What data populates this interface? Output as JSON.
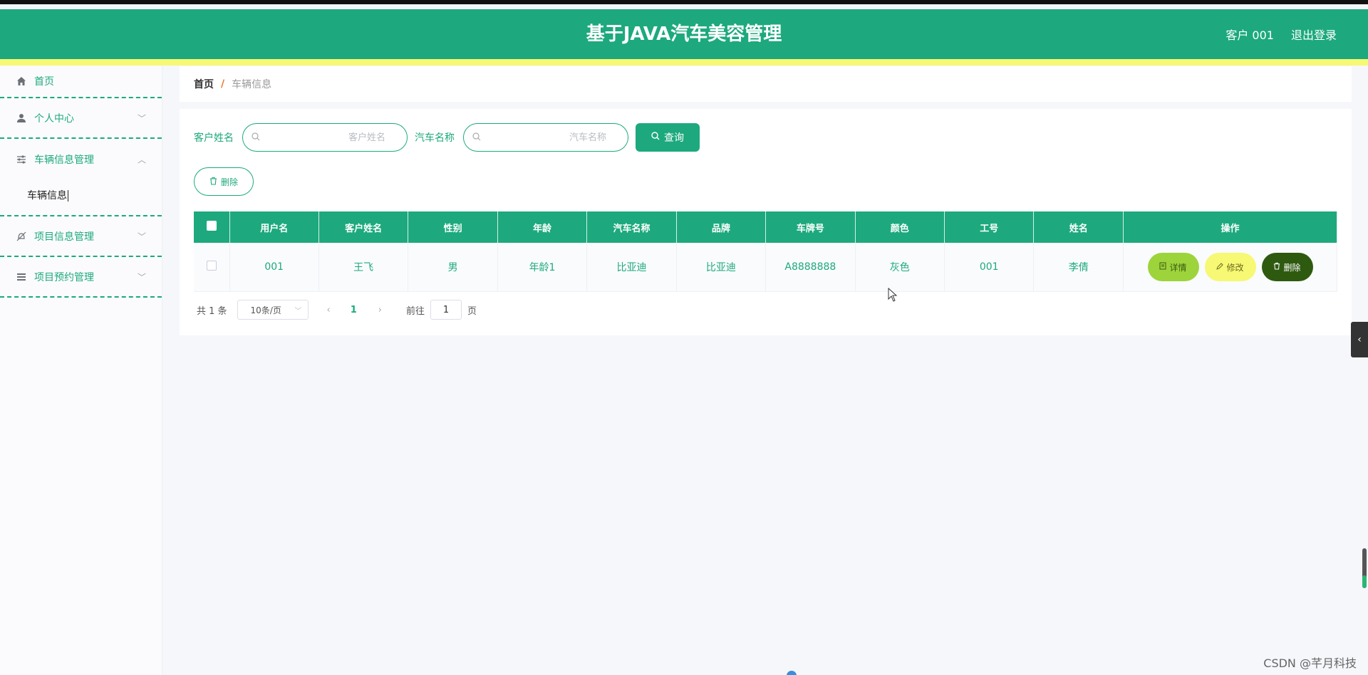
{
  "header": {
    "title": "基于JAVA汽车美容管理",
    "user_label": "客户 001",
    "logout_label": "退出登录"
  },
  "sidebar": {
    "items": [
      {
        "label": "首页",
        "icon": "home-icon"
      },
      {
        "label": "个人中心",
        "icon": "user-icon"
      },
      {
        "label": "车辆信息管理",
        "icon": "sliders-icon",
        "expanded": true,
        "sub": [
          {
            "label": "车辆信息"
          }
        ]
      },
      {
        "label": "项目信息管理",
        "icon": "bell-off-icon"
      },
      {
        "label": "项目预约管理",
        "icon": "list-icon"
      }
    ]
  },
  "breadcrumb": {
    "home": "首页",
    "separator": "/",
    "current": "车辆信息"
  },
  "search": {
    "customer_label": "客户姓名",
    "customer_placeholder": "客户姓名",
    "car_label": "汽车名称",
    "car_placeholder": "汽车名称",
    "query_label": "查询"
  },
  "toolbar": {
    "delete_label": "删除"
  },
  "table": {
    "columns": [
      "用户名",
      "客户姓名",
      "性别",
      "年龄",
      "汽车名称",
      "品牌",
      "车牌号",
      "颜色",
      "工号",
      "姓名",
      "操作"
    ],
    "rows": [
      {
        "username": "001",
        "customer_name": "王飞",
        "gender": "男",
        "age": "年龄1",
        "car_name": "比亚迪",
        "brand": "比亚迪",
        "plate": "A8888888",
        "color": "灰色",
        "staff_no": "001",
        "name": "李倩"
      }
    ],
    "actions": {
      "detail": "详情",
      "edit": "修改",
      "delete": "删除"
    }
  },
  "pagination": {
    "total": "共 1 条",
    "page_size": "10条/页",
    "current_page": "1",
    "goto_label": "前往",
    "goto_value": "1",
    "page_suffix": "页"
  },
  "watermark": "CSDN @芊月科技",
  "colors": {
    "primary": "#1da97d",
    "accent_yellow": "#f7f873",
    "detail_green": "#9ed43b",
    "delete_dark": "#2e5a10"
  }
}
